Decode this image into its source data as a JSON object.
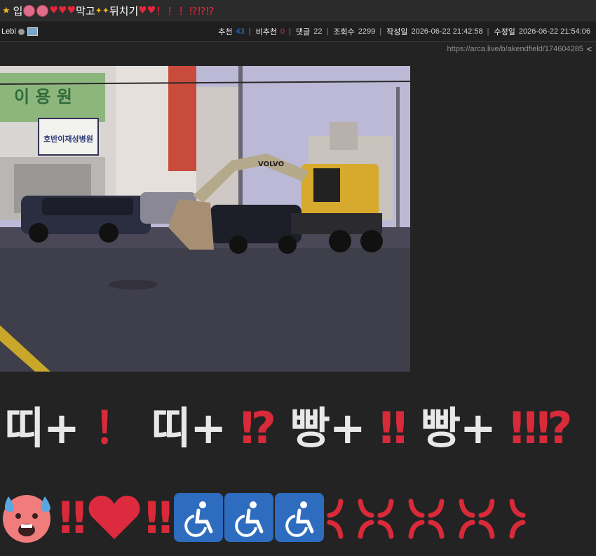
{
  "title": {
    "star": "★",
    "part1": "입",
    "part2": "막고",
    "part3": "뒤치기",
    "ending": "！！！⁉⁉⁉"
  },
  "meta": {
    "author": "Lebi",
    "stats": [
      {
        "label": "추천",
        "value": "43",
        "color": "#2f78d8"
      },
      {
        "label": "비추천",
        "value": "0",
        "color": "#d0343f"
      },
      {
        "label": "댓글",
        "value": "22",
        "color": "#cfcfcf"
      },
      {
        "label": "조회수",
        "value": "2299",
        "color": "#cfcfcf"
      },
      {
        "label": "작성일",
        "value": "2026-06-22 21:42:58",
        "color": "#cfcfcf"
      },
      {
        "label": "수정일",
        "value": "2026-06-22 21:54:06",
        "color": "#cfcfcf"
      }
    ]
  },
  "url": "https://arca.live/b/akendfield/174604285",
  "photo_signs": {
    "sign1": "이 용 원",
    "sign2": "호반이재성병원",
    "excavator_brand": "VOLVO"
  },
  "big_text": {
    "w1": "띠+",
    "r1": "！",
    "w2": "띠+",
    "r2": "⁉",
    "w3": "빵+",
    "r3": "‼",
    "w4": "빵+",
    "r4": "‼⁉"
  },
  "emoji_row": {
    "bang1": "‼",
    "bang2": "‼"
  },
  "icons": [
    "star-icon",
    "heart-icon",
    "sparkle-icon",
    "verified-icon",
    "share-icon",
    "cold-sweat-face-icon",
    "heart-icon",
    "wheelchair-icon",
    "anger-icon"
  ]
}
